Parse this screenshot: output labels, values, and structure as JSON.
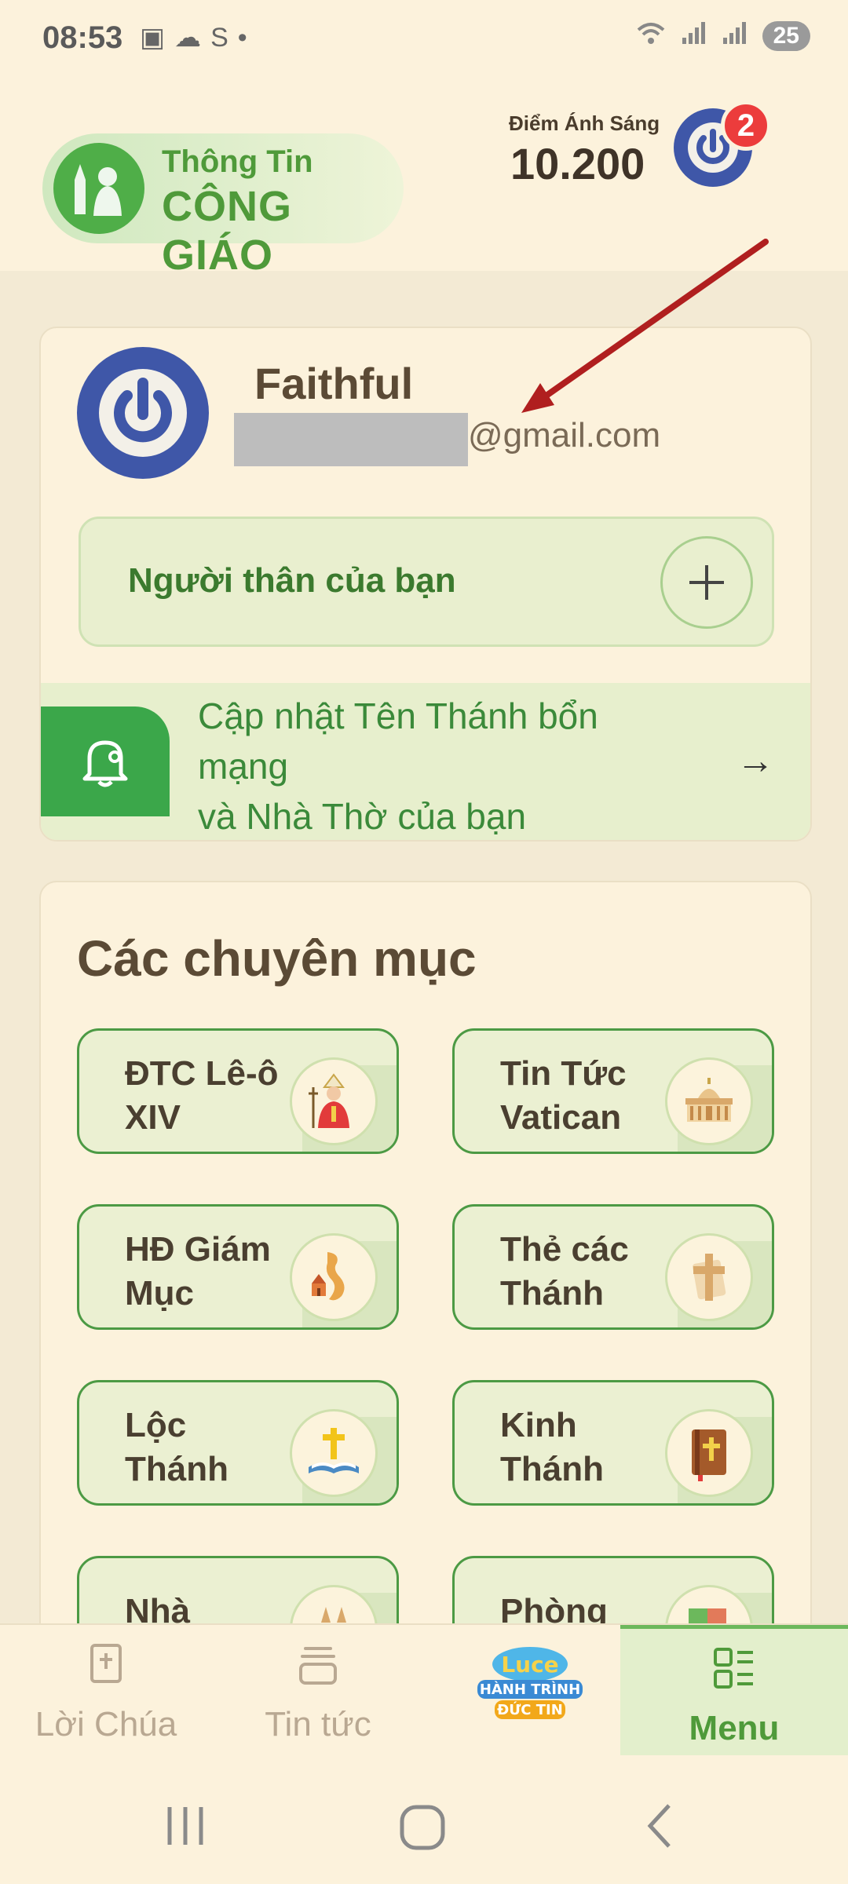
{
  "status_bar": {
    "time": "08:53",
    "battery": "25"
  },
  "header": {
    "logo_line1": "Thông Tin",
    "logo_line2": "CÔNG GIÁO",
    "points_label": "Điểm Ánh Sáng",
    "points_value": "10.200",
    "notification_count": "2"
  },
  "profile": {
    "name": "Faithful",
    "email_domain": "@gmail.com",
    "relatives_label": "Người thân của bạn",
    "update_text": "Cập nhật Tên Thánh bổn mạng\nvà Nhà Thờ của bạn"
  },
  "categories": {
    "title": "Các chuyên mục",
    "items": [
      {
        "label": "ĐTC Lê-ô XIV",
        "icon": "pope-icon"
      },
      {
        "label": "Tin Tức Vatican",
        "icon": "vatican-icon"
      },
      {
        "label": "HĐ Giám Mục",
        "icon": "vietnam-map-icon"
      },
      {
        "label": "Thẻ các Thánh",
        "icon": "cross-card-icon"
      },
      {
        "label": "Lộc Thánh",
        "icon": "bible-cross-icon"
      },
      {
        "label": "Kinh Thánh",
        "icon": "holy-book-icon"
      },
      {
        "label": "Nhà",
        "icon": "church-icon"
      },
      {
        "label": "Phòng",
        "icon": "puzzle-icon"
      }
    ]
  },
  "bottom_nav": {
    "items": [
      {
        "label": "Lời Chúa"
      },
      {
        "label": "Tin tức"
      },
      {
        "label": "Menu"
      }
    ],
    "game_logo": {
      "line1": "Luce",
      "line2": "HÀNH TRÌNH",
      "line3": "ĐỨC TIN"
    }
  },
  "colors": {
    "accent": "#4f9a3a",
    "background": "#FCF2DC",
    "badge": "#ec3c3c"
  }
}
